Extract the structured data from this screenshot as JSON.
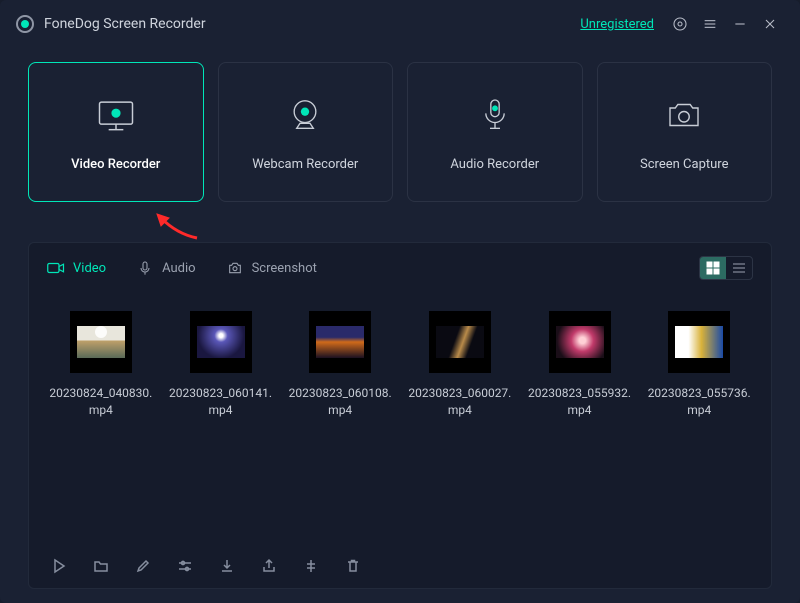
{
  "header": {
    "title": "FoneDog Screen Recorder",
    "unregistered_label": "Unregistered"
  },
  "modes": {
    "video": "Video Recorder",
    "webcam": "Webcam Recorder",
    "audio": "Audio Recorder",
    "capture": "Screen Capture"
  },
  "tabs": {
    "video": "Video",
    "audio": "Audio",
    "screenshot": "Screenshot"
  },
  "files": [
    {
      "name": "20230824_040830.mp4"
    },
    {
      "name": "20230823_060141.mp4"
    },
    {
      "name": "20230823_060108.mp4"
    },
    {
      "name": "20230823_060027.mp4"
    },
    {
      "name": "20230823_055932.mp4"
    },
    {
      "name": "20230823_055736.mp4"
    }
  ]
}
